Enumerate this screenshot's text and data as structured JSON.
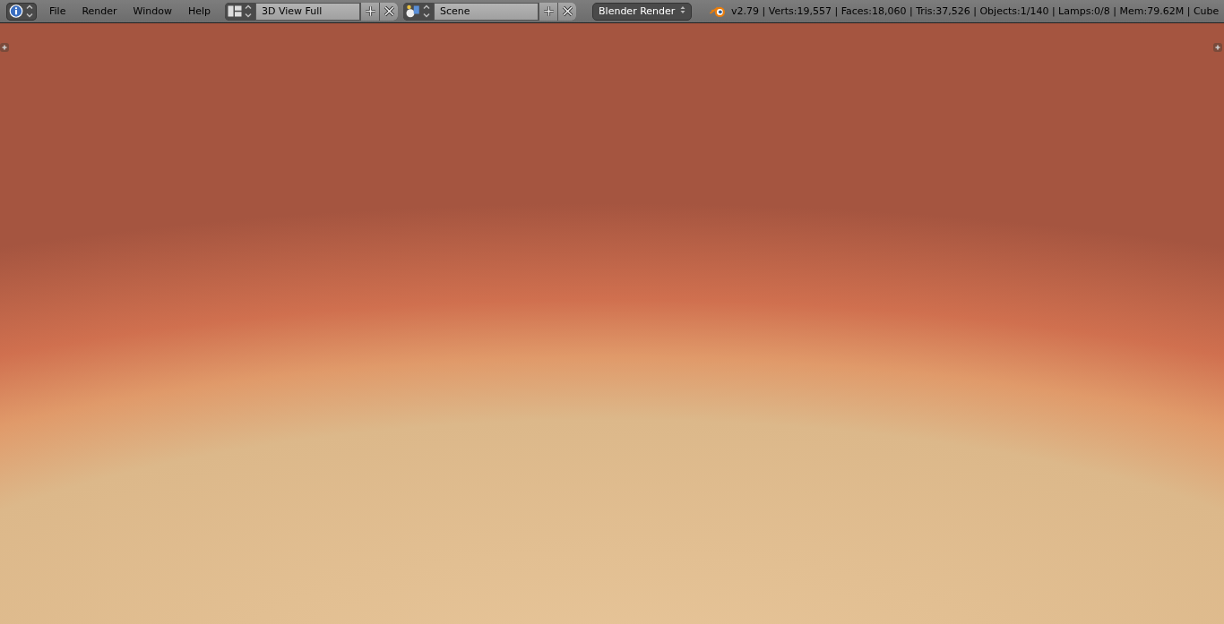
{
  "header": {
    "menus": [
      {
        "label": "File"
      },
      {
        "label": "Render"
      },
      {
        "label": "Window"
      },
      {
        "label": "Help"
      }
    ],
    "screen_layout": {
      "value": "3D View Full"
    },
    "scene": {
      "value": "Scene"
    },
    "render_engine": {
      "value": "Blender Render"
    },
    "stats": "v2.79 | Verts:19,557 | Faces:18,060 | Tris:37,526 | Objects:1/140 | Lamps:0/8 | Mem:79.62M | Cube"
  }
}
